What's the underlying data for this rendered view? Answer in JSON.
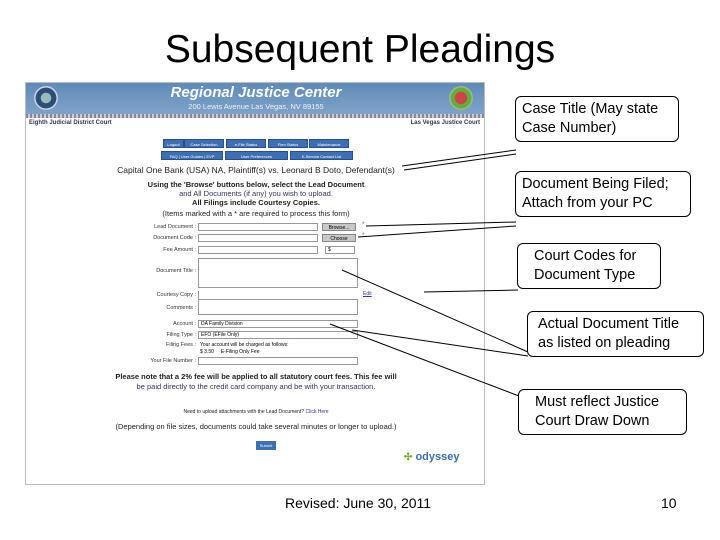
{
  "slide": {
    "title": "Subsequent Pleadings",
    "footer": "Revised: June 30, 2011",
    "page_number": "10"
  },
  "screenshot": {
    "header_title": "Regional Justice Center",
    "header_address": "200 Lewis Avenue Las Vegas, NV 89155",
    "left_court": "Eighth Judicial District Court",
    "right_court": "Las Vegas Justice Court",
    "nav_row1": [
      "Logout",
      "Case Selection",
      "e-File Status",
      "Firm Status",
      "Maintenance"
    ],
    "nav_row2": [
      "FAQ | User Guides | EVP",
      "User Preferences",
      "E-Service Contact List"
    ],
    "case_title": "Capital One Bank (USA) NA, Plaintiff(s) vs. Leonard B Doto, Defendant(s)",
    "instructions": [
      "Using the 'Browse' buttons below, select the Lead Document",
      "and All Documents (if any) you wish to upload.",
      "All Filings include Courtesy Copies."
    ],
    "required_note": "(Items marked with a * are required to process this form)",
    "form": {
      "lead_document": "Lead Document :",
      "browse": "Browse...",
      "document_code": "Document Code :",
      "choose": "Choose",
      "fee_amount": "Fee Amount :",
      "fee_value": "$",
      "document_title": "Document Title :",
      "courtesy_copy": "Courtesy Copy :",
      "edit": "Edit",
      "comments": "Comments :",
      "account": "Account :",
      "account_value": "DA Family Division",
      "filing_type": "Filing Type :",
      "filing_type_value": "EFO (EFile Only)",
      "filing_fees": "Filing Fees :",
      "fees_line1": "Your account will be charged as follows:",
      "fees_line2": "$ 3.50     E-Filing Only Fee",
      "file_number": "Your File Number :"
    },
    "fee_note": [
      "Please note that a 2% fee will be applied to all statutory court fees. This fee will",
      "be paid directly to the credit card company and be with your transaction."
    ],
    "upload_note": "Need to upload attachments with the Lead Document?",
    "upload_link": "Click Here",
    "depending_note": "(Depending on file sizes, documents could take several minutes or longer to upload.)",
    "submit": "Submit",
    "logo": "odyssey"
  },
  "callouts": [
    {
      "text": "Case Title (May state Case Number)"
    },
    {
      "text": "Document Being Filed; Attach from your PC"
    },
    {
      "text": "Court Codes for Document Type"
    },
    {
      "text": "Actual Document Title as listed on pleading"
    },
    {
      "text": "Must reflect Justice Court Draw Down"
    }
  ]
}
